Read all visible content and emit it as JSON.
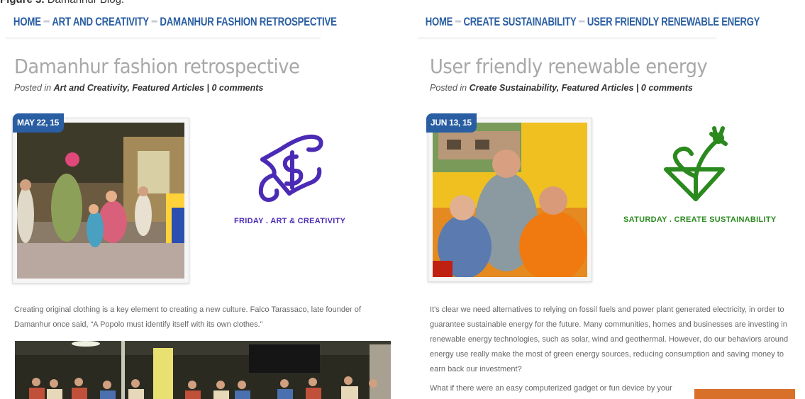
{
  "caption": {
    "label": "Figure 3.",
    "text": "Damanhur Blog."
  },
  "colors": {
    "accent": "#2a5ea3",
    "purple": "#4b2bb5",
    "green": "#2b8a1e",
    "title_grey": "#a8a8a8"
  },
  "left": {
    "breadcrumb": [
      "HOME",
      "ART AND CREATIVITY",
      "DAMANHUR FASHION RETROSPECTIVE"
    ],
    "title": "Damanhur fashion retrospective",
    "meta": {
      "posted_in": "Posted in",
      "cat1": "Art and Creativity",
      "comma": ",",
      "cat2": "Featured Articles",
      "sep": "|",
      "comments": "0 comments"
    },
    "date": "MAY 22, 15",
    "logo_icon": "purple-s-hand-symbol",
    "logo_caption": "FRIDAY . ART & CREATIVITY",
    "body": [
      "Creating original clothing is a key element to creating a new culture. Falco Tarassaco, late founder of Damanhur once said, “A Popolo must identify itself with its own clothes.”"
    ]
  },
  "right": {
    "breadcrumb": [
      "HOME",
      "CREATE SUSTAINABILITY",
      "USER FRIENDLY RENEWABLE ENERGY"
    ],
    "title": "User friendly renewable energy",
    "meta": {
      "posted_in": "Posted in",
      "cat1": "Create Sustainability",
      "comma": ",",
      "cat2": "Featured Articles",
      "sep": "|",
      "comments": "0 comments"
    },
    "date": "JUN 13, 15",
    "logo_icon": "green-plant-triangle-symbol",
    "logo_caption": "SATURDAY . CREATE SUSTAINABILITY",
    "body": [
      "It's clear we need alternatives to relying on fossil fuels and power plant generated electricity, in order to guarantee sustainable energy for the future. Many communities, homes and businesses are investing in renewable energy technologies, such as solar, wind and geothermal. However, do our behaviors around energy use really make the most of green energy sources, reducing consumption and saving money to earn back our investment?",
      "What if there were an easy computerized gadget or fun device by your"
    ]
  }
}
